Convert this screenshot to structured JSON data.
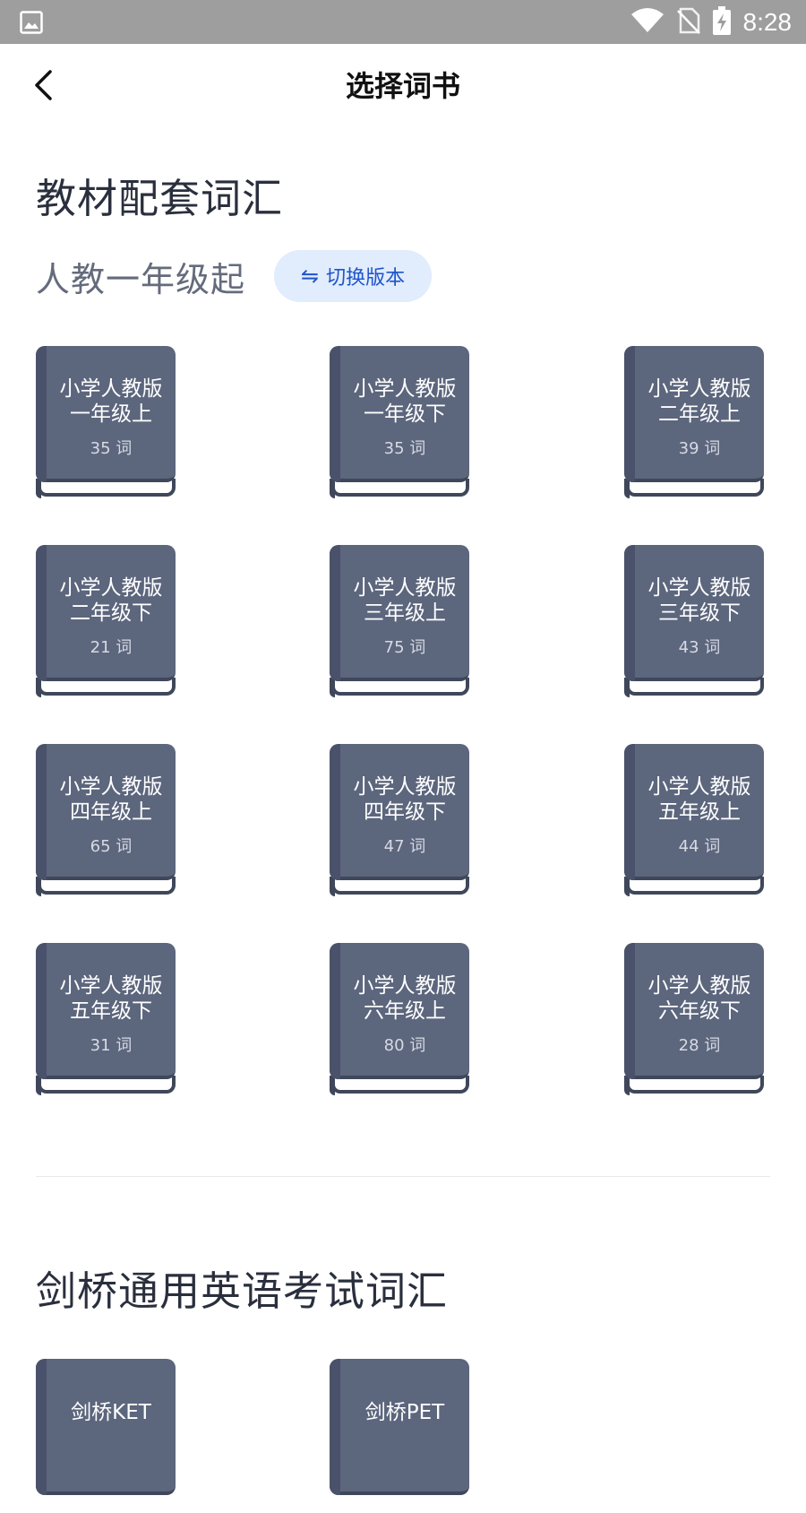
{
  "status": {
    "time": "8:28"
  },
  "nav": {
    "title": "选择词书"
  },
  "section1": {
    "title": "教材配套词汇",
    "edition": "人教一年级起",
    "switch_label": "切换版本",
    "books": [
      {
        "line1": "小学人教版",
        "line2": "一年级上",
        "count": "35 词"
      },
      {
        "line1": "小学人教版",
        "line2": "一年级下",
        "count": "35 词"
      },
      {
        "line1": "小学人教版",
        "line2": "二年级上",
        "count": "39 词"
      },
      {
        "line1": "小学人教版",
        "line2": "二年级下",
        "count": "21 词"
      },
      {
        "line1": "小学人教版",
        "line2": "三年级上",
        "count": "75 词"
      },
      {
        "line1": "小学人教版",
        "line2": "三年级下",
        "count": "43 词"
      },
      {
        "line1": "小学人教版",
        "line2": "四年级上",
        "count": "65 词"
      },
      {
        "line1": "小学人教版",
        "line2": "四年级下",
        "count": "47 词"
      },
      {
        "line1": "小学人教版",
        "line2": "五年级上",
        "count": "44 词"
      },
      {
        "line1": "小学人教版",
        "line2": "五年级下",
        "count": "31 词"
      },
      {
        "line1": "小学人教版",
        "line2": "六年级上",
        "count": "80 词"
      },
      {
        "line1": "小学人教版",
        "line2": "六年级下",
        "count": "28 词"
      }
    ]
  },
  "section2": {
    "title": "剑桥通用英语考试词汇",
    "books": [
      {
        "line1": "剑桥KET"
      },
      {
        "line1": "剑桥PET"
      }
    ]
  }
}
